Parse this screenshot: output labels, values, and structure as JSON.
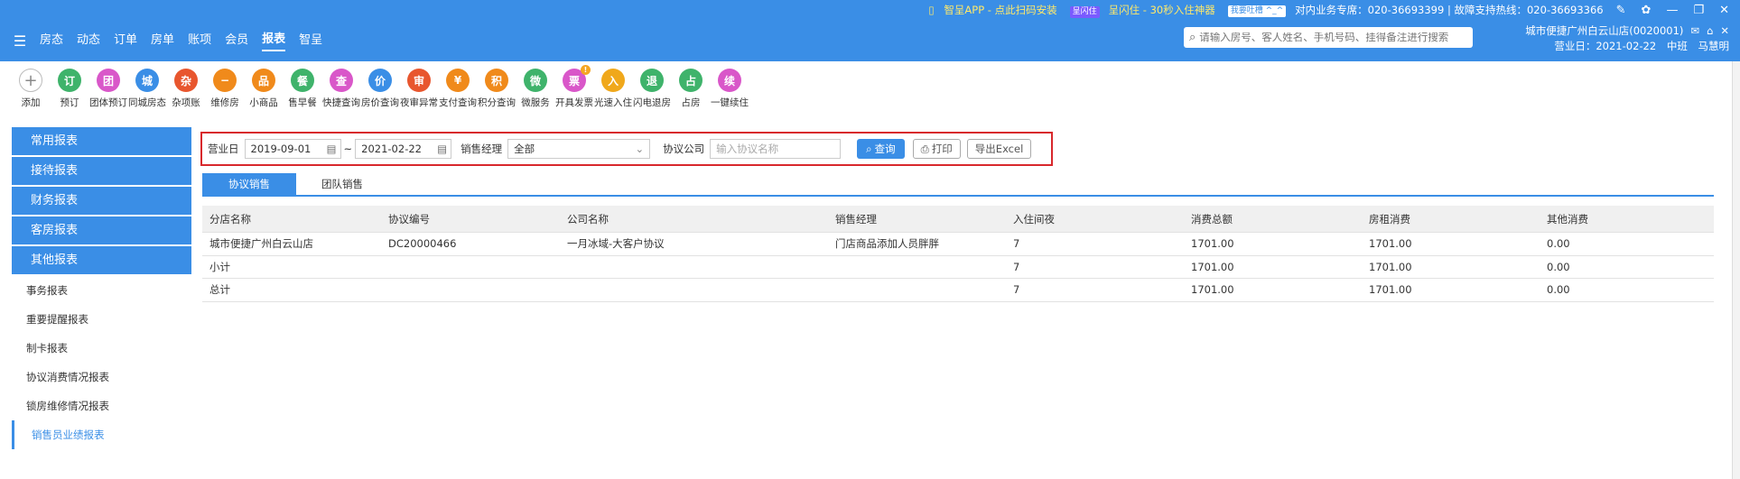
{
  "topstrip": {
    "app_text": "智呈APP - 点此扫码安装",
    "flash_tag": "呈闪住",
    "flash_text": "呈闪住 - 30秒入住神器",
    "feedback_tag": "我要吐槽 ^_^",
    "biz_hotline": "对内业务专席：020-36693399 | 故障支持热线：020-36693366"
  },
  "nav": {
    "items": [
      "房态",
      "动态",
      "订单",
      "房单",
      "账项",
      "会员",
      "报表",
      "智呈"
    ],
    "active": "报表"
  },
  "search": {
    "placeholder": "请输入房号、客人姓名、手机号码、挂得备注进行搜索"
  },
  "hotel": {
    "name": "城市便捷广州白云山店(0020001)",
    "business_day": "营业日：2021-02-22",
    "shift": "中班",
    "user": "马慧明"
  },
  "toolbar": [
    {
      "label": "添加",
      "icon": "plus-icon",
      "color": "#ffffff",
      "glyph": "+"
    },
    {
      "label": "预订",
      "icon": "booking-icon",
      "color": "#3fb36b",
      "glyph": "订"
    },
    {
      "label": "团体预订",
      "icon": "group-booking-icon",
      "color": "#d957c9",
      "glyph": "团"
    },
    {
      "label": "同城房态",
      "icon": "city-room-icon",
      "color": "#3a8ee6",
      "glyph": "城"
    },
    {
      "label": "杂项账",
      "icon": "misc-bill-icon",
      "color": "#e8562e",
      "glyph": "杂"
    },
    {
      "label": "维修房",
      "icon": "repair-room-icon",
      "color": "#f08a1b",
      "glyph": "−"
    },
    {
      "label": "小商品",
      "icon": "goods-icon",
      "color": "#f08a1b",
      "glyph": "品"
    },
    {
      "label": "售早餐",
      "icon": "breakfast-icon",
      "color": "#3fb36b",
      "glyph": "餐"
    },
    {
      "label": "快捷查询",
      "icon": "quick-query-icon",
      "color": "#d957c9",
      "glyph": "查"
    },
    {
      "label": "房价查询",
      "icon": "price-query-icon",
      "color": "#3a8ee6",
      "glyph": "价"
    },
    {
      "label": "夜审异常",
      "icon": "night-audit-icon",
      "color": "#e8562e",
      "glyph": "审"
    },
    {
      "label": "支付查询",
      "icon": "payment-query-icon",
      "color": "#f08a1b",
      "glyph": "¥"
    },
    {
      "label": "积分查询",
      "icon": "points-query-icon",
      "color": "#f08a1b",
      "glyph": "积"
    },
    {
      "label": "微服务",
      "icon": "micro-service-icon",
      "color": "#3fb36b",
      "glyph": "微"
    },
    {
      "label": "开具发票",
      "icon": "invoice-icon",
      "color": "#d957c9",
      "glyph": "票",
      "badge": "!"
    },
    {
      "label": "光速入住",
      "icon": "fast-checkin-icon",
      "color": "#f0a81b",
      "glyph": "入"
    },
    {
      "label": "闪电退房",
      "icon": "fast-checkout-icon",
      "color": "#3fb36b",
      "glyph": "退"
    },
    {
      "label": "占房",
      "icon": "occupy-room-icon",
      "color": "#3fb36b",
      "glyph": "占"
    },
    {
      "label": "一键续住",
      "icon": "extend-stay-icon",
      "color": "#d957c9",
      "glyph": "续"
    }
  ],
  "sidebar": {
    "categories": [
      "常用报表",
      "接待报表",
      "财务报表",
      "客房报表",
      "其他报表"
    ],
    "items": [
      "事务报表",
      "重要提醒报表",
      "制卡报表",
      "协议消费情况报表",
      "锁房维修情况报表",
      "销售员业绩报表"
    ],
    "active_item": "销售员业绩报表"
  },
  "filter": {
    "business_day_label": "营业日",
    "date_from": "2019-09-01",
    "tilde": "~",
    "date_to": "2021-02-22",
    "manager_label": "销售经理",
    "manager_value": "全部",
    "company_label": "协议公司",
    "company_placeholder": "输入协议名称",
    "query_label": "查询",
    "print_label": "打印",
    "export_label": "导出Excel"
  },
  "tabs": [
    "协议销售",
    "团队销售"
  ],
  "table": {
    "columns": [
      "分店名称",
      "协议编号",
      "公司名称",
      "销售经理",
      "入住间夜",
      "消费总额",
      "房租消费",
      "其他消费"
    ],
    "rows": [
      [
        "城市便捷广州白云山店",
        "DC20000466",
        "一月冰域-大客户协议",
        "门店商品添加人员胖胖",
        "7",
        "1701.00",
        "1701.00",
        "0.00"
      ],
      [
        "小计",
        "",
        "",
        "",
        "7",
        "1701.00",
        "1701.00",
        "0.00"
      ],
      [
        "总计",
        "",
        "",
        "",
        "7",
        "1701.00",
        "1701.00",
        "0.00"
      ]
    ]
  }
}
